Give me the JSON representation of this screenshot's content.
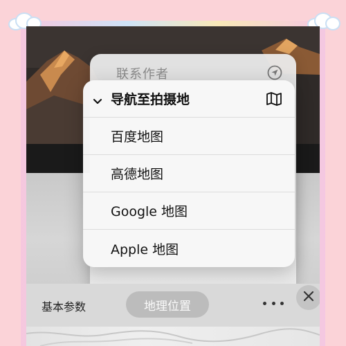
{
  "context_menu": {
    "contact_author": "联系作者",
    "navigate_header": "导航至拍摄地",
    "options": [
      "百度地图",
      "高德地图",
      "Google 地图",
      "Apple 地图"
    ]
  },
  "toolbar": {
    "basic_params": "基本参数",
    "location_tab": "地理位置"
  },
  "icons": {
    "contact": "location-arrow-icon",
    "navigate": "map-icon",
    "check": "chevron-down-icon",
    "more": "more-icon",
    "close": "close-icon"
  },
  "colors": {
    "background": "#fbd3d8",
    "menu_bg": "#f7f7f7",
    "pill_bg": "#bcbcbc"
  }
}
